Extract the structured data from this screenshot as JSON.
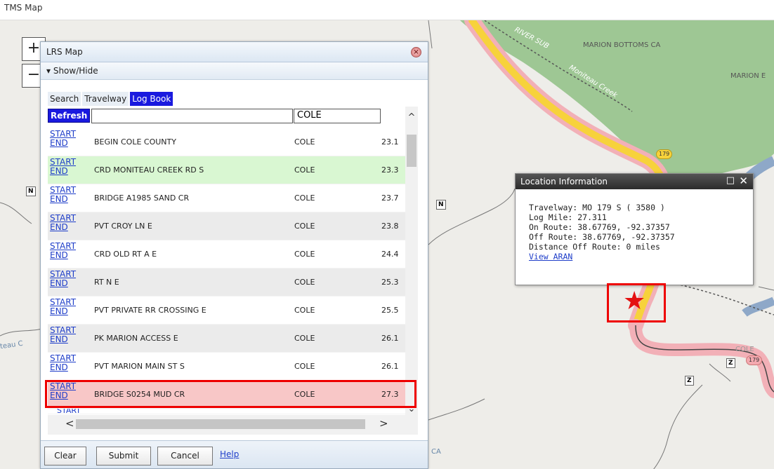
{
  "app": {
    "title": "TMS Map"
  },
  "map": {
    "zoom_in": "+",
    "zoom_out": "−",
    "labels": {
      "marion_bottoms": "MARION BOTTOMS CA",
      "marion_e": "MARION E",
      "river_sub": "RIVER SUB",
      "moniteau_creek": "Moniteau Creek",
      "teau_c": "teau C",
      "cole": "COLE",
      "ca": "CA"
    },
    "shields": {
      "n1": "N",
      "n2": "N",
      "z1": "Z",
      "z2": "Z"
    },
    "routes": {
      "r179_top": "179",
      "r179_bottom": "179"
    }
  },
  "lrs_panel": {
    "title": "LRS Map",
    "close_symbol": "×",
    "show_hide": "▾ Show/Hide",
    "tabs": [
      {
        "label": "Search",
        "active": false
      },
      {
        "label": "Travelway",
        "active": false
      },
      {
        "label": "Log Book",
        "active": true
      }
    ],
    "refresh_label": "Refresh",
    "search_value": "",
    "county_value": "COLE",
    "start_label": "START",
    "end_label": "END",
    "partial_row": "START",
    "rows": [
      {
        "desc": "BEGIN COLE COUNTY",
        "county": "COLE",
        "mile": "23.1"
      },
      {
        "desc": "CRD MONITEAU CREEK RD S",
        "county": "COLE",
        "mile": "23.3"
      },
      {
        "desc": "BRIDGE A1985 SAND CR",
        "county": "COLE",
        "mile": "23.7"
      },
      {
        "desc": "PVT CROY LN E",
        "county": "COLE",
        "mile": "23.8"
      },
      {
        "desc": "CRD OLD RT A E",
        "county": "COLE",
        "mile": "24.4"
      },
      {
        "desc": "RT N E",
        "county": "COLE",
        "mile": "25.3"
      },
      {
        "desc": "PVT PRIVATE RR CROSSING E",
        "county": "COLE",
        "mile": "25.5"
      },
      {
        "desc": "PK MARION ACCESS E",
        "county": "COLE",
        "mile": "26.1"
      },
      {
        "desc": "PVT MARION MAIN ST S",
        "county": "COLE",
        "mile": "26.1"
      },
      {
        "desc": "BRIDGE S0254 MUD CR",
        "county": "COLE",
        "mile": "27.3"
      }
    ],
    "scroll": {
      "up": "^",
      "down": "⌄",
      "left": "<",
      "right": ">"
    },
    "footer": {
      "clear": "Clear",
      "submit": "Submit",
      "cancel": "Cancel",
      "help": "Help"
    }
  },
  "location_info": {
    "title": "Location Information",
    "max_symbol": "□",
    "close_symbol": "✕",
    "travelway": "Travelway: MO 179 S ( 3580 )",
    "log_mile": "Log Mile: 27.311",
    "on_route": "On Route: 38.67769, -92.37357",
    "off_route": "Off Route: 38.67769, -92.37357",
    "distance": "Distance Off Route: 0 miles",
    "view_aran": "View ARAN"
  },
  "marker": {
    "symbol": "★"
  },
  "colors": {
    "active_tab": "#1a1adf",
    "selected_row": "#f8c7c7",
    "highlight_row": "#d9f7d2",
    "alt_row": "#ebebeb",
    "annotation": "#e00000",
    "forest": "#9ec794",
    "route_yellow": "#f7d23b",
    "route_pink": "#f4a9b0"
  }
}
